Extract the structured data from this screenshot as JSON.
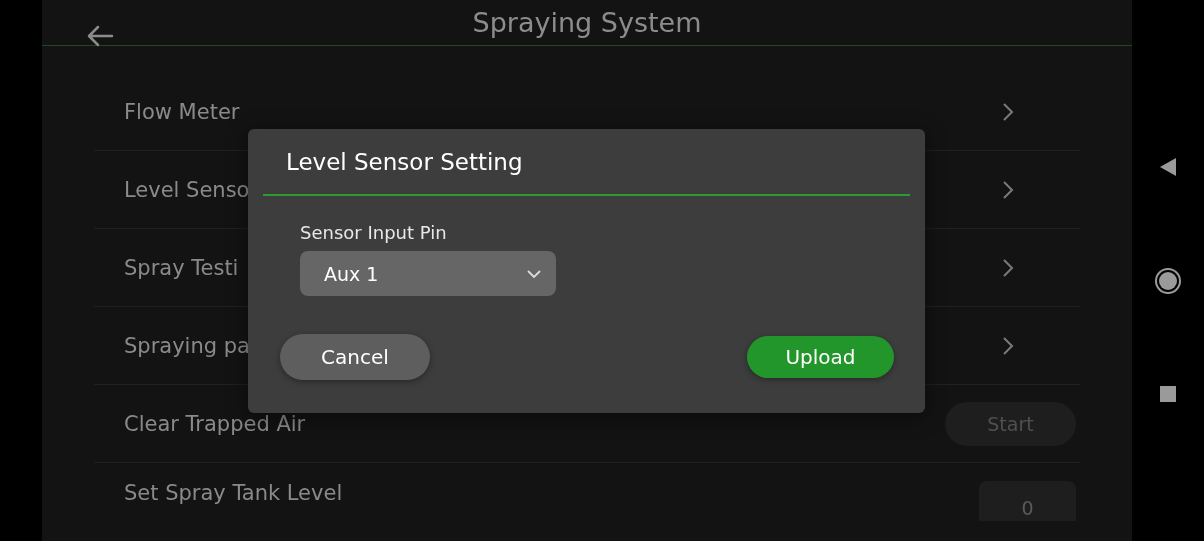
{
  "header": {
    "title": "Spraying System"
  },
  "settings": [
    {
      "kind": "link",
      "label": "Flow Meter"
    },
    {
      "kind": "link",
      "label": "Level Senso"
    },
    {
      "kind": "link",
      "label": "Spray Testi"
    },
    {
      "kind": "link",
      "label": "Spraying pa"
    },
    {
      "kind": "action",
      "label": "Clear Trapped Air",
      "button": "Start"
    },
    {
      "kind": "value",
      "label": "Set Spray Tank Level",
      "value": "0"
    }
  ],
  "dialog": {
    "title": "Level Sensor Setting",
    "field_label": "Sensor Input Pin",
    "select": {
      "value": "Aux 1"
    },
    "buttons": [
      {
        "kind": "secondary",
        "label": "Cancel"
      },
      {
        "kind": "primary",
        "label": "Upload"
      }
    ]
  }
}
